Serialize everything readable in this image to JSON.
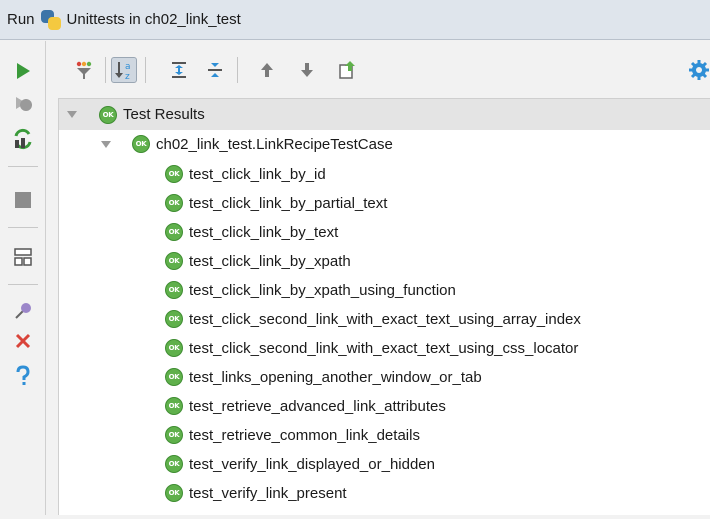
{
  "titlebar": {
    "run_label": "Run",
    "title": "Unittests in ch02_link_test",
    "icon": "python-icon"
  },
  "left_toolbar": {
    "items": [
      "rerun-icon",
      "stop-rerun-icon",
      "rerun-failed-icon",
      "stop-icon",
      "layout-icon",
      "pin-icon",
      "close-icon",
      "help-icon"
    ]
  },
  "top_toolbar": {
    "items": [
      "show-passed-icon",
      "sort-alpha-icon",
      "expand-all-icon",
      "collapse-all-icon",
      "previous-icon",
      "next-icon",
      "export-icon",
      "settings-icon"
    ],
    "sort_alpha_letters": "a z"
  },
  "tree": {
    "badge_text": "OK",
    "root": {
      "label": "Test Results",
      "status": "OK"
    },
    "suite": {
      "label": "ch02_link_test.LinkRecipeTestCase",
      "status": "OK"
    },
    "tests": [
      "test_click_link_by_id",
      "test_click_link_by_partial_text",
      "test_click_link_by_text",
      "test_click_link_by_xpath",
      "test_click_link_by_xpath_using_function",
      "test_click_second_link_with_exact_text_using_array_index",
      "test_click_second_link_with_exact_text_using_css_locator",
      "test_links_opening_another_window_or_tab",
      "test_retrieve_advanced_link_attributes",
      "test_retrieve_common_link_details",
      "test_verify_link_displayed_or_hidden",
      "test_verify_link_present"
    ]
  },
  "colors": {
    "pass_green": "#5fb04b",
    "run_green": "#3a9a3a",
    "error_red": "#d9443a",
    "help_blue": "#2f8fd6",
    "titlebar_bg": "#dfe5ec"
  }
}
